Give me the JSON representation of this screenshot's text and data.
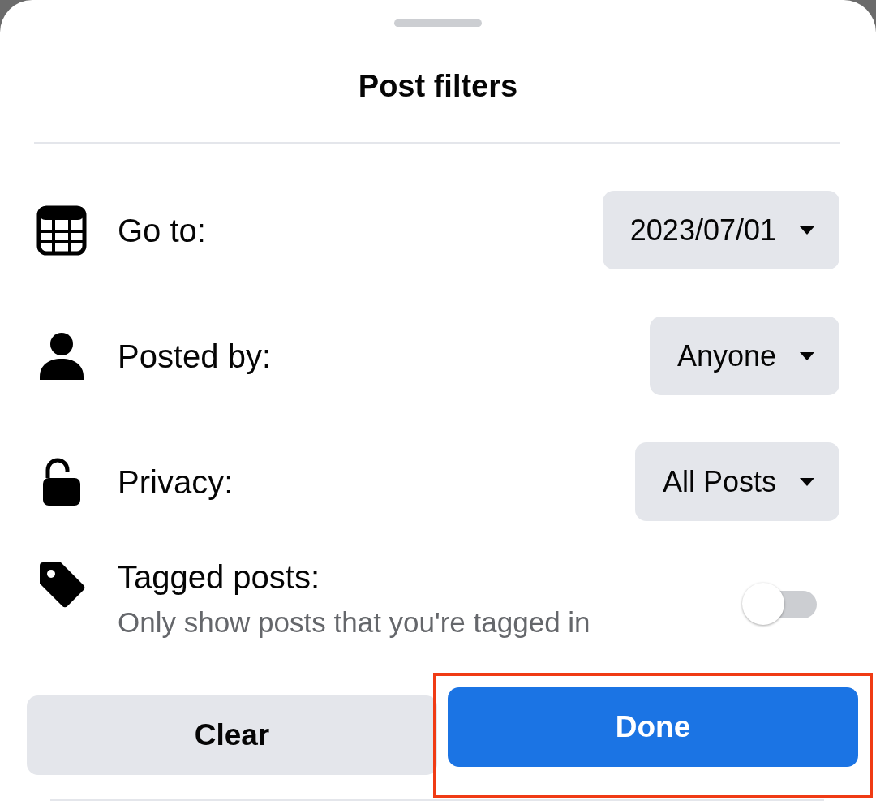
{
  "sheet": {
    "title": "Post filters"
  },
  "filters": [
    {
      "kind": "dropdown",
      "label": "Go to:",
      "value": "2023/07/01"
    },
    {
      "kind": "dropdown",
      "label": "Posted by:",
      "value": "Anyone"
    },
    {
      "kind": "dropdown",
      "label": "Privacy:",
      "value": "All Posts"
    },
    {
      "kind": "toggle",
      "label": "Tagged posts:",
      "description": "Only show posts that you're tagged in",
      "on": false
    }
  ],
  "buttons": [
    {
      "kind": "secondary",
      "label": "Clear",
      "highlighted": false
    },
    {
      "kind": "primary",
      "label": "Done",
      "highlighted": true
    }
  ]
}
